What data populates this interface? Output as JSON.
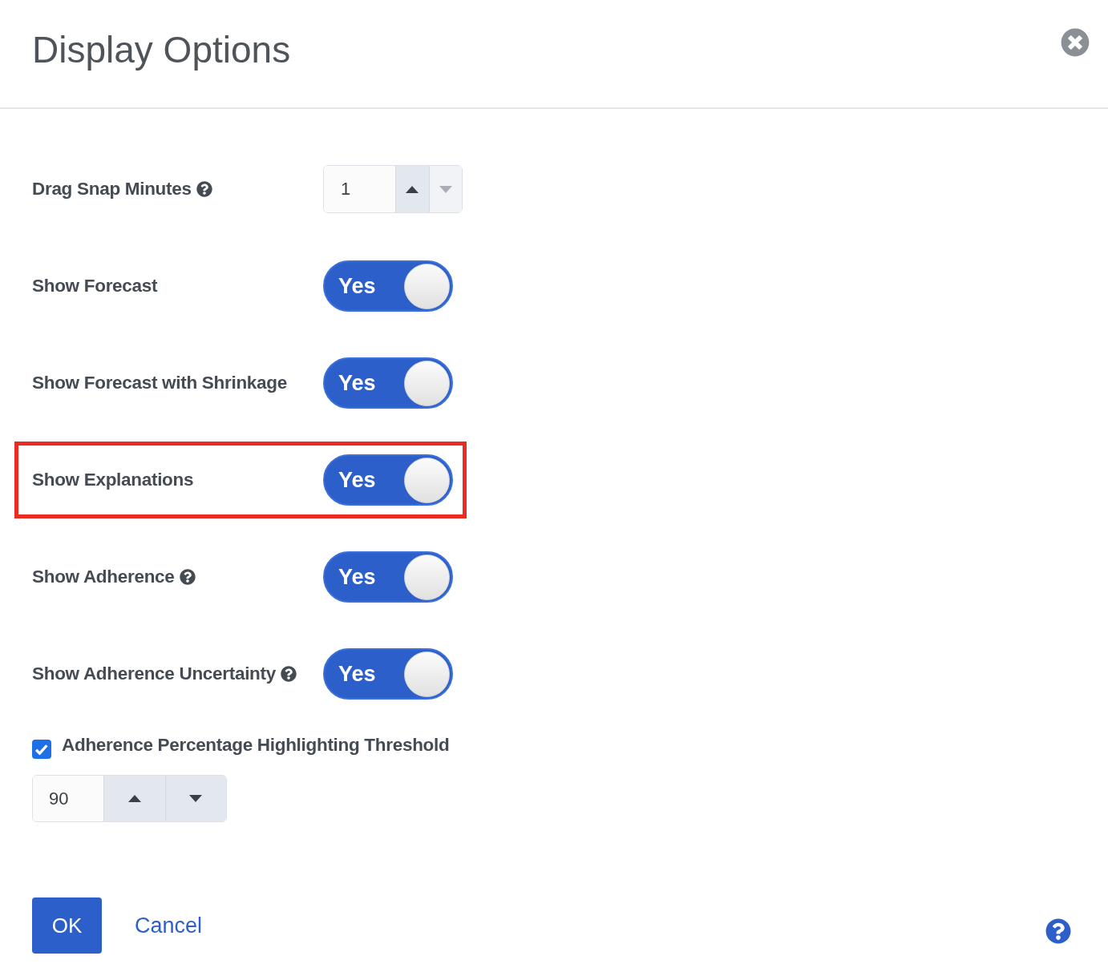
{
  "dialog": {
    "title": "Display Options"
  },
  "settings": [
    {
      "kind": "spinner",
      "label": "Drag Snap Minutes",
      "help": true,
      "highlighted": false,
      "value": "1",
      "up_disabled": false,
      "down_disabled": true
    },
    {
      "kind": "toggle",
      "label": "Show Forecast",
      "help": false,
      "highlighted": false,
      "on": true,
      "state_text": "Yes"
    },
    {
      "kind": "toggle",
      "label": "Show Forecast with Shrinkage",
      "help": false,
      "highlighted": false,
      "on": true,
      "state_text": "Yes"
    },
    {
      "kind": "toggle",
      "label": "Show Explanations",
      "help": false,
      "highlighted": true,
      "on": true,
      "state_text": "Yes"
    },
    {
      "kind": "toggle",
      "label": "Show Adherence",
      "help": true,
      "highlighted": false,
      "on": true,
      "state_text": "Yes"
    },
    {
      "kind": "toggle",
      "label": "Show Adherence Uncertainty",
      "help": true,
      "highlighted": false,
      "on": true,
      "state_text": "Yes"
    }
  ],
  "threshold": {
    "checked": true,
    "label": "Adherence Percentage Highlighting Threshold",
    "value": "90",
    "up_disabled": false,
    "down_disabled": false
  },
  "footer": {
    "ok": "OK",
    "cancel": "Cancel"
  }
}
